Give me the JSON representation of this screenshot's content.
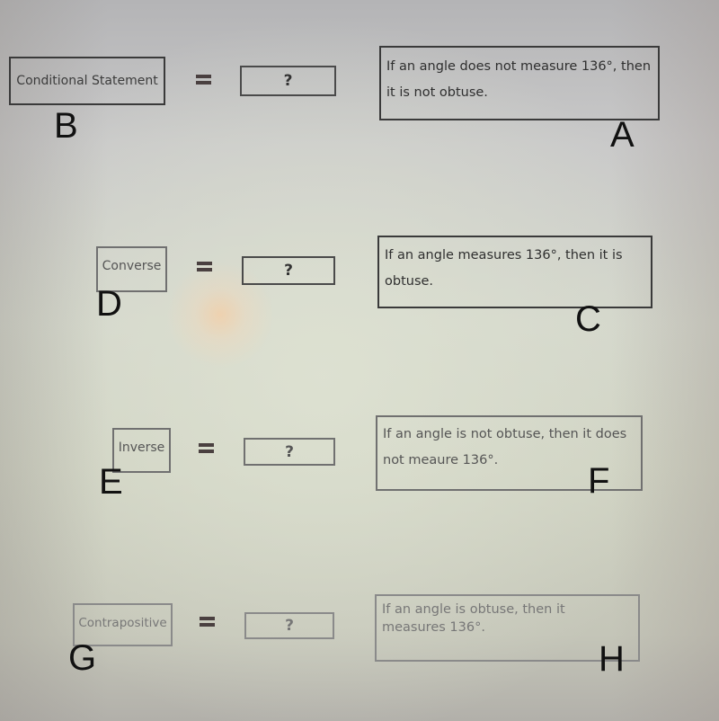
{
  "rows": [
    {
      "term": "Conditional Statement",
      "term_letter": "B",
      "equals": "=",
      "answer_placeholder": "?",
      "statement": "If an angle does not measure 136°, then it is not obtuse.",
      "statement_letter": "A"
    },
    {
      "term": "Converse",
      "term_letter": "D",
      "equals": "=",
      "answer_placeholder": "?",
      "statement": "If an angle measures 136°, then it is obtuse.",
      "statement_letter": "C"
    },
    {
      "term": "Inverse",
      "term_letter": "E",
      "equals": "=",
      "answer_placeholder": "?",
      "statement": "If an angle is not obtuse, then it does not meaure 136°.",
      "statement_letter": "F"
    },
    {
      "term": "Contrapositive",
      "term_letter": "G",
      "equals": "=",
      "answer_placeholder": "?",
      "statement": "If an angle is obtuse, then it measures 136°.",
      "statement_letter": "H"
    }
  ]
}
